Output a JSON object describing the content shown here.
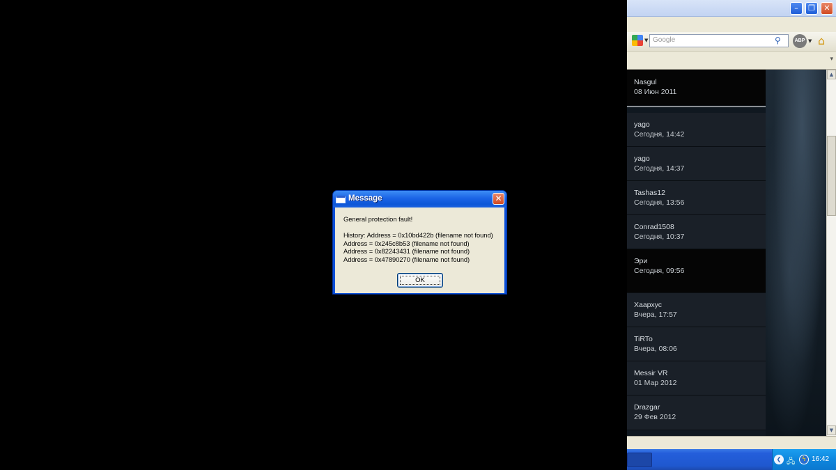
{
  "browser": {
    "search_placeholder": "Google",
    "abp_label": "ABP",
    "icons": {
      "minimize": "minimize-icon",
      "restore": "restore-icon",
      "close": "close-icon",
      "home": "home-icon",
      "search": "search-icon"
    }
  },
  "list": {
    "pinned": {
      "name": "Nasgul",
      "date": "08 Июн 2011"
    },
    "items": [
      {
        "name": "yago",
        "date": "Сегодня, 14:42"
      },
      {
        "name": "yago",
        "date": "Сегодня, 14:37"
      },
      {
        "name": "Tashas12",
        "date": "Сегодня, 13:56"
      },
      {
        "name": "Conrad1508",
        "date": "Сегодня, 10:37"
      },
      {
        "name": "Эри",
        "date": "Сегодня, 09:56"
      },
      {
        "name": "Хаархус",
        "date": "Вчера, 17:57"
      },
      {
        "name": "TiRTo",
        "date": "Вчера, 08:06"
      },
      {
        "name": "Messir VR",
        "date": "01 Мар 2012"
      },
      {
        "name": "Drazgar",
        "date": "29 Фев 2012"
      }
    ]
  },
  "taskbar": {
    "clock": "16:42"
  },
  "dialog": {
    "title": "Message",
    "message": "General protection fault!",
    "history_lines": [
      "History: Address = 0x10bd422b (filename not found)",
      "Address = 0x245c8b53 (filename not found)",
      "Address = 0x82243431 (filename not found)",
      "Address = 0x47890270 (filename not found)"
    ],
    "ok_label": "OK"
  },
  "colors": {
    "desktop": "#000000",
    "xp_blue": "#0a4fd8",
    "dialog_face": "#ece9d8",
    "list_bg": "#1a2028"
  }
}
